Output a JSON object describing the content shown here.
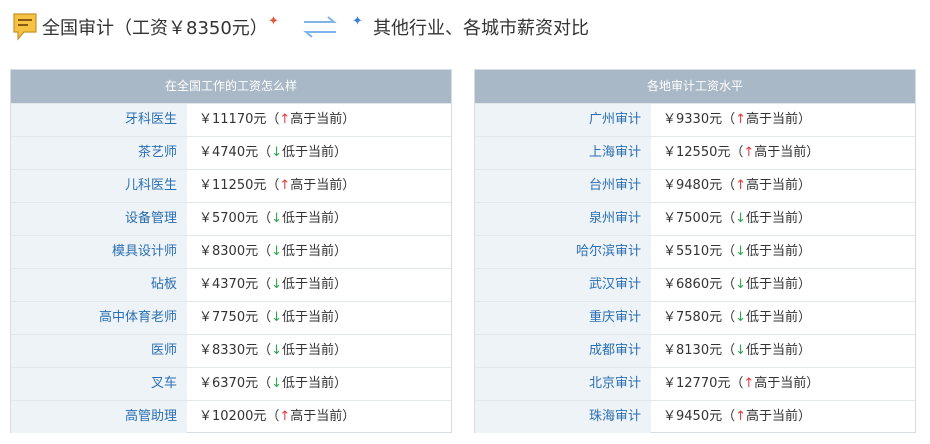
{
  "header": {
    "left_title": "全国审计（工资￥8350元）",
    "right_title": "其他行业、各城市薪资对比",
    "star_glyph": "✦",
    "accent_red": "#e05a3c",
    "accent_blue": "#3b7ed6"
  },
  "left_panel": {
    "title": "在全国工作的工资怎么样",
    "rows": [
      {
        "name": "牙科医生",
        "salary": "￥11170元",
        "dir": "up",
        "arrow": "↑",
        "note": "高于当前"
      },
      {
        "name": "茶艺师",
        "salary": "￥4740元",
        "dir": "down",
        "arrow": "↓",
        "note": "低于当前"
      },
      {
        "name": "儿科医生",
        "salary": "￥11250元",
        "dir": "up",
        "arrow": "↑",
        "note": "高于当前"
      },
      {
        "name": "设备管理",
        "salary": "￥5700元",
        "dir": "down",
        "arrow": "↓",
        "note": "低于当前"
      },
      {
        "name": "模具设计师",
        "salary": "￥8300元",
        "dir": "down",
        "arrow": "↓",
        "note": "低于当前"
      },
      {
        "name": "砧板",
        "salary": "￥4370元",
        "dir": "down",
        "arrow": "↓",
        "note": "低于当前"
      },
      {
        "name": "高中体育老师",
        "salary": "￥7750元",
        "dir": "down",
        "arrow": "↓",
        "note": "低于当前"
      },
      {
        "name": "医师",
        "salary": "￥8330元",
        "dir": "down",
        "arrow": "↓",
        "note": "低于当前"
      },
      {
        "name": "叉车",
        "salary": "￥6370元",
        "dir": "down",
        "arrow": "↓",
        "note": "低于当前"
      },
      {
        "name": "高管助理",
        "salary": "￥10200元",
        "dir": "up",
        "arrow": "↑",
        "note": "高于当前"
      }
    ]
  },
  "right_panel": {
    "title": "各地审计工资水平",
    "rows": [
      {
        "name": "广州审计",
        "salary": "￥9330元",
        "dir": "up",
        "arrow": "↑",
        "note": "高于当前"
      },
      {
        "name": "上海审计",
        "salary": "￥12550元",
        "dir": "up",
        "arrow": "↑",
        "note": "高于当前"
      },
      {
        "name": "台州审计",
        "salary": "￥9480元",
        "dir": "up",
        "arrow": "↑",
        "note": "高于当前"
      },
      {
        "name": "泉州审计",
        "salary": "￥7500元",
        "dir": "down",
        "arrow": "↓",
        "note": "低于当前"
      },
      {
        "name": "哈尔滨审计",
        "salary": "￥5510元",
        "dir": "down",
        "arrow": "↓",
        "note": "低于当前"
      },
      {
        "name": "武汉审计",
        "salary": "￥6860元",
        "dir": "down",
        "arrow": "↓",
        "note": "低于当前"
      },
      {
        "name": "重庆审计",
        "salary": "￥7580元",
        "dir": "down",
        "arrow": "↓",
        "note": "低于当前"
      },
      {
        "name": "成都审计",
        "salary": "￥8130元",
        "dir": "down",
        "arrow": "↓",
        "note": "低于当前"
      },
      {
        "name": "北京审计",
        "salary": "￥12770元",
        "dir": "up",
        "arrow": "↑",
        "note": "高于当前"
      },
      {
        "name": "珠海审计",
        "salary": "￥9450元",
        "dir": "up",
        "arrow": "↑",
        "note": "高于当前"
      }
    ]
  }
}
